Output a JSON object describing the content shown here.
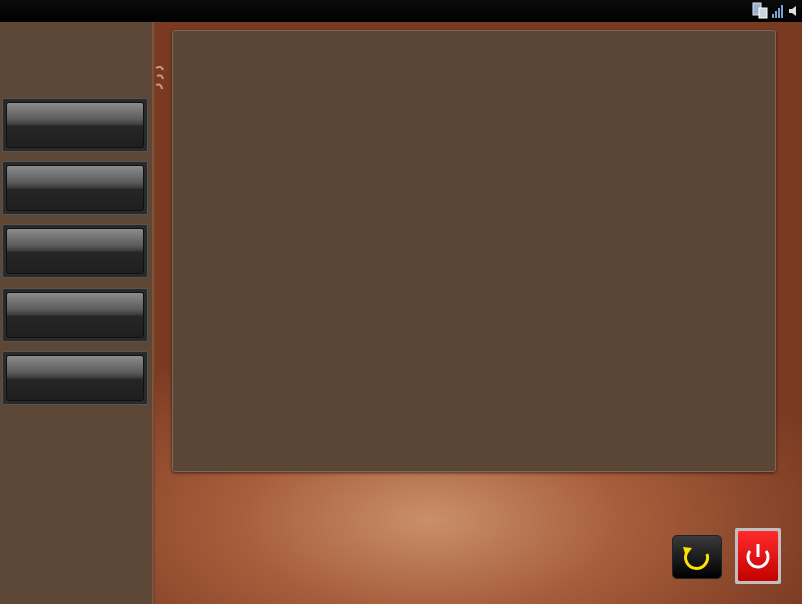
{
  "topbar": {
    "tray_icons": [
      "network-icon",
      "signal-icon",
      "volume-icon"
    ]
  },
  "sidebar": {
    "buttons": [
      {
        "label": ""
      },
      {
        "label": ""
      },
      {
        "label": ""
      },
      {
        "label": ""
      },
      {
        "label": ""
      }
    ]
  },
  "main_panel": {
    "content": ""
  },
  "actions": {
    "reload_icon": "refresh-icon",
    "power_icon": "power-icon"
  },
  "colors": {
    "panel": "#5b4636",
    "sidebar": "#5c4636",
    "power": "#e00000",
    "reload_arrow": "#ffe200"
  }
}
